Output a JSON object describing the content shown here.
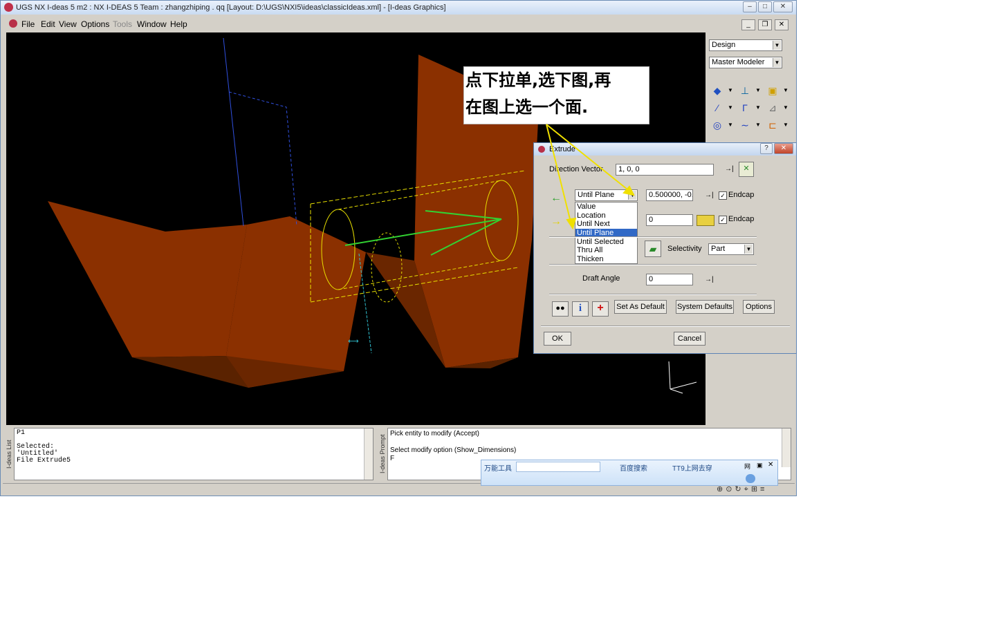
{
  "titlebar": {
    "title": "UGS NX I-deas 5 m2 :    NX I-DEAS 5 Team : zhangzhiping . qq    [Layout: D:\\UGS\\NXI5\\ideas\\classicIdeas.xml]    - [I-deas Graphics]",
    "btn_min": "–",
    "btn_max": "□",
    "btn_close": "✕"
  },
  "menu": {
    "items": [
      "File",
      "Edit",
      "View",
      "Options",
      "Tools",
      "Window",
      "Help"
    ],
    "mdi_min": "_",
    "mdi_restore": "❐",
    "mdi_close": "✕"
  },
  "side": {
    "task": "Design",
    "app": "Master Modeler"
  },
  "callout": {
    "line1": "点下拉单,选下图,再",
    "line2": "在图上选一个面."
  },
  "dialog": {
    "title": "Extrude",
    "help_btn": "?",
    "close_btn": "✕",
    "direction_label": "Direction Vector",
    "direction_value": "1, 0, 0",
    "extent1_selected": "Until Plane",
    "extent1_value": "0.500000, -0.",
    "endcap_label": "Endcap",
    "extent2_value": "0",
    "list_options": [
      "Value",
      "Location",
      "Until Next",
      "Until Plane",
      "Until Selected",
      "Thru All",
      "Thicken"
    ],
    "list_selected_index": 3,
    "selectivity_label": "Selectivity",
    "selectivity_value": "Part",
    "draft_label": "Draft Angle",
    "draft_value": "0",
    "set_as_default": "Set As Default",
    "system_defaults": "System Defaults",
    "options": "Options",
    "ok": "OK",
    "cancel": "Cancel"
  },
  "list_panel": {
    "tab": "I-deas List",
    "text": "P1\n\nSelected:\n'Untitled'\nFile Extrude5"
  },
  "prompt_panel": {
    "tab": "I-deas Prompt",
    "text": "Pick entity to modify (Accept)\n\nSelect modify option (Show_Dimensions)\nF"
  },
  "qq_bar": {
    "item1": "万能工具",
    "item2": "百度搜索",
    "item3": "TT9上网去穿"
  },
  "colors": {
    "face": "#8b3000",
    "face_dark": "#5a2200",
    "wire_yellow": "#e8e000",
    "arrow_green": "#32d232",
    "selection": "#3169c6"
  }
}
